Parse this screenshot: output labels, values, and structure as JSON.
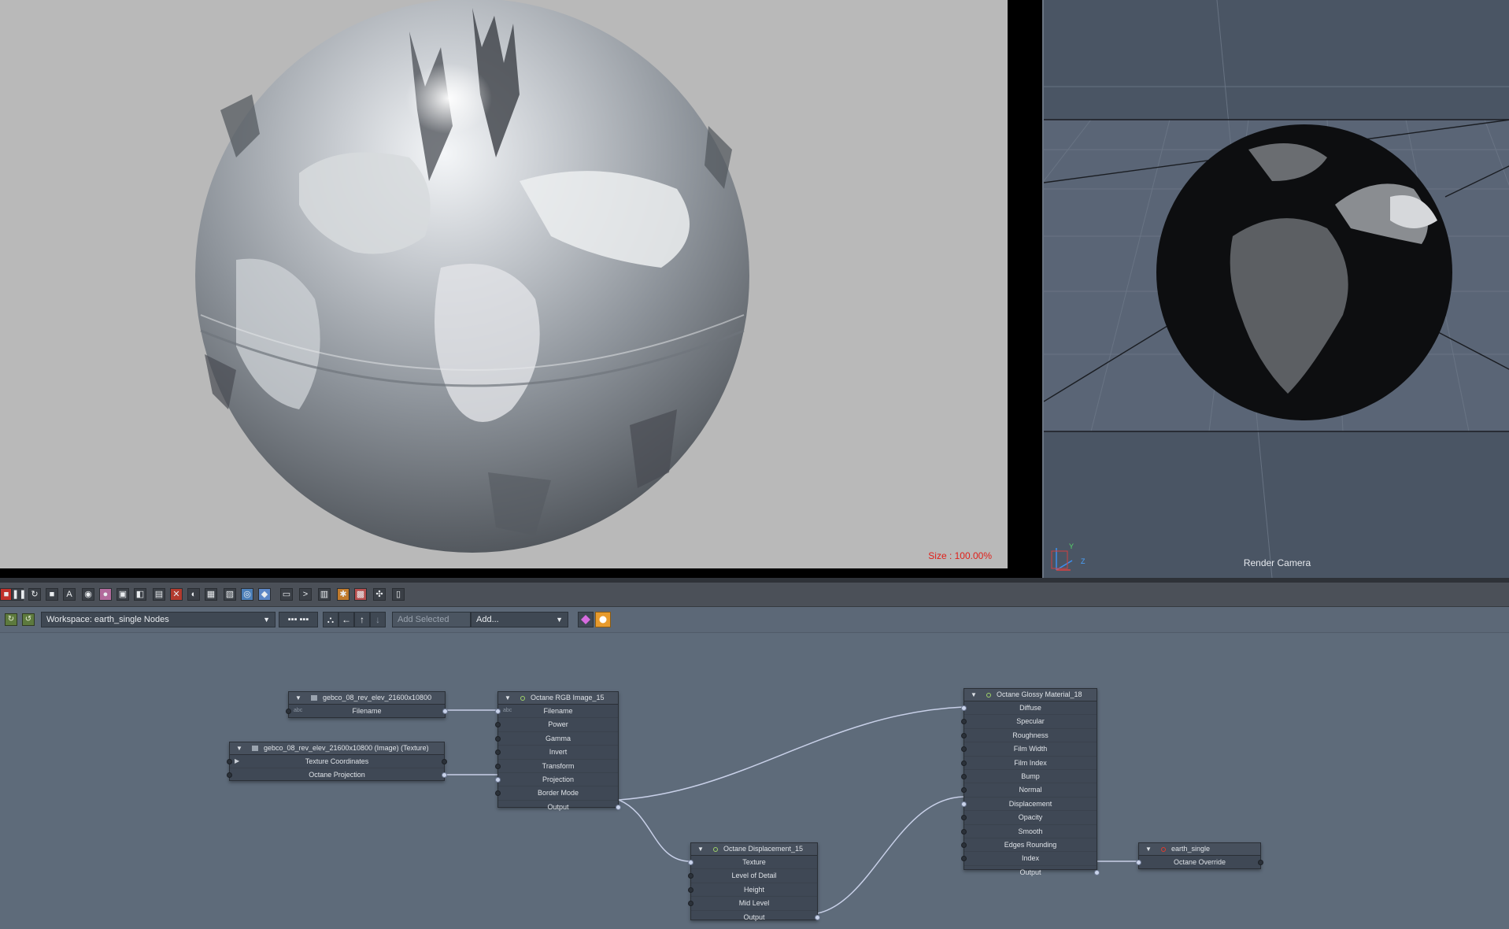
{
  "render_view": {
    "size_text": "Size : 100.00%"
  },
  "viewport_3d": {
    "camera_label": "Render Camera",
    "axis_labels": {
      "y": "Y",
      "z": "Z"
    }
  },
  "toolbar": {
    "buttons": [
      "stop-icon",
      "pause-icon",
      "refresh-icon",
      "stop-square-icon",
      "afi-icon",
      "render-icon",
      "color-icon",
      "region-icon",
      "region-icon",
      "camera-icon",
      "reset-icon",
      "material-icon",
      "image-icon",
      "picture-icon",
      "shot-icon",
      "env-icon",
      "scene-icon",
      "terminal-icon",
      "chart-icon",
      "settings-icon",
      "texture-icon",
      "network-icon",
      "info-icon"
    ]
  },
  "workspace": {
    "label": "Workspace: earth_single Nodes",
    "add_selected_placeholder": "Add Selected",
    "add_label": "Add..."
  },
  "nodes": {
    "gebco_image": {
      "title": "gebco_08_rev_elev_21600x10800",
      "rows": [
        "Filename"
      ]
    },
    "gebco_texture": {
      "title": "gebco_08_rev_elev_21600x10800 (Image) (Texture)",
      "rows": [
        "Texture Coordinates",
        "Octane Projection"
      ]
    },
    "rgb_image": {
      "title": "Octane RGB Image_15",
      "rows": [
        "Filename",
        "Power",
        "Gamma",
        "Invert",
        "Transform",
        "Projection",
        "Border Mode",
        "Output"
      ]
    },
    "glossy_material": {
      "title": "Octane Glossy Material_18",
      "rows": [
        "Diffuse",
        "Specular",
        "Roughness",
        "Film Width",
        "Film Index",
        "Bump",
        "Normal",
        "Displacement",
        "Opacity",
        "Smooth",
        "Edges Rounding",
        "Index",
        "Output"
      ]
    },
    "displacement": {
      "title": "Octane Displacement_15",
      "rows": [
        "Texture",
        "Level of Detail",
        "Height",
        "Mid Level",
        "Output"
      ]
    },
    "earth_single": {
      "title": "earth_single",
      "rows": [
        "Octane Override"
      ]
    }
  },
  "colors": {
    "node_bg": "#3f4855",
    "graph_bg": "#5e6b7a",
    "wire": "#c8d0e8",
    "size_text": "#e0201a",
    "active_key": "#e79a2c"
  }
}
